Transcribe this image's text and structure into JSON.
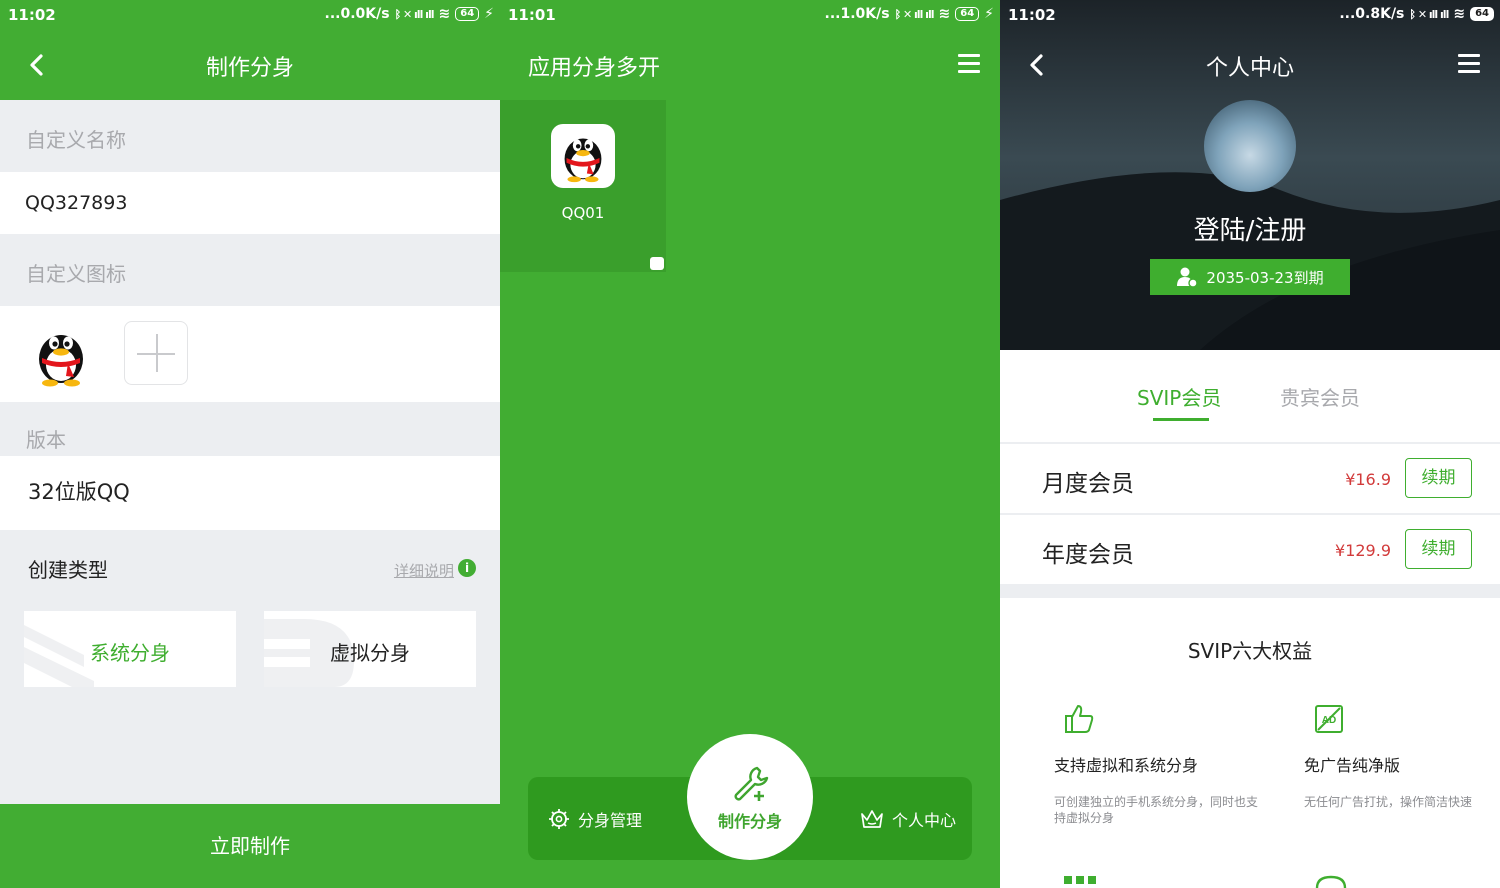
{
  "panel1": {
    "status": {
      "time": "11:02",
      "speed": "...0.0K/s",
      "battery": "64"
    },
    "title": "制作分身",
    "custom_name_label": "自定义名称",
    "custom_name_value": "QQ327893",
    "custom_icon_label": "自定义图标",
    "version_label": "版本",
    "version_value": "32位版QQ",
    "create_type_title": "创建类型",
    "detail_link": "详细说明",
    "type_system": "系统分身",
    "type_virtual": "虚拟分身",
    "create_button": "立即制作"
  },
  "panel2": {
    "status": {
      "time": "11:01",
      "speed": "...1.0K/s",
      "battery": "64"
    },
    "title": "应用分身多开",
    "apps": [
      {
        "label": "QQ01"
      }
    ],
    "nav": {
      "manage": "分身管理",
      "create": "制作分身",
      "profile": "个人中心"
    }
  },
  "panel3": {
    "status": {
      "time": "11:02",
      "speed": "...0.8K/s",
      "battery": "64"
    },
    "title": "个人中心",
    "login": "登陆/注册",
    "expire": "2035-03-23到期",
    "tabs": [
      "SVIP会员",
      "贵宾会员"
    ],
    "plans": [
      {
        "name": "月度会员",
        "price": "¥16.9",
        "action": "续期"
      },
      {
        "name": "年度会员",
        "price": "¥129.9",
        "action": "续期"
      }
    ],
    "benefits_title": "SVIP六大权益",
    "benefits": [
      {
        "title": "支持虚拟和系统分身",
        "desc": "可创建独立的手机系统分身，同时也支持虚拟分身"
      },
      {
        "title": "免广告纯净版",
        "desc": "无任何广告打扰，操作简洁快速"
      }
    ]
  },
  "colors": {
    "brand_green": "#42ad33",
    "price_red": "#d23b3b"
  }
}
